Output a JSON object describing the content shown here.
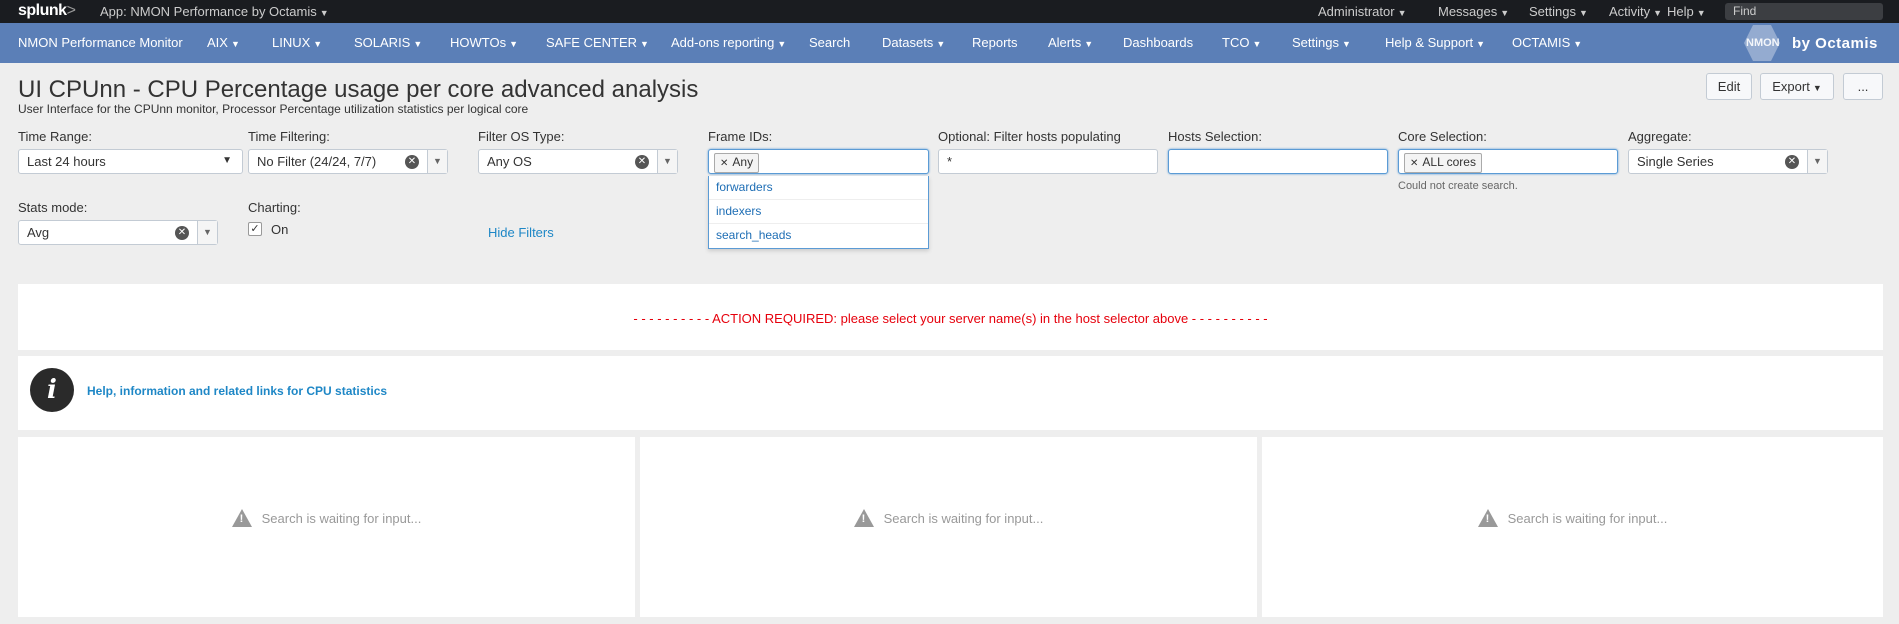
{
  "topbar": {
    "logo": "splunk",
    "logo_chevron": ">",
    "app_label": "App: NMON Performance by Octamis",
    "menus": [
      "Administrator",
      "Messages",
      "Settings",
      "Activity",
      "Help"
    ],
    "find_placeholder": "Find"
  },
  "nav": {
    "items": [
      "NMON Performance Monitor",
      "AIX",
      "LINUX",
      "SOLARIS",
      "HOWTOs",
      "SAFE CENTER",
      "Add-ons reporting",
      "Search",
      "Datasets",
      "Reports",
      "Alerts",
      "Dashboards",
      "TCO",
      "Settings",
      "Help & Support",
      "OCTAMIS"
    ],
    "brand_hex": "NMON",
    "brand": "by Octamis"
  },
  "page": {
    "title": "UI CPUnn - CPU Percentage usage per core advanced analysis",
    "description": "User Interface for the CPUnn monitor, Processor Percentage utilization statistics per logical core",
    "edit_label": "Edit",
    "export_label": "Export",
    "more_label": "..."
  },
  "filters": {
    "time_range": {
      "label": "Time Range:",
      "value": "Last 24 hours"
    },
    "time_filtering": {
      "label": "Time Filtering:",
      "value": "No Filter (24/24, 7/7)"
    },
    "os_type": {
      "label": "Filter OS Type:",
      "value": "Any OS"
    },
    "frame_ids": {
      "label": "Frame IDs:",
      "token": "Any",
      "options": [
        "forwarders",
        "indexers",
        "search_heads"
      ]
    },
    "hosts_populating": {
      "label": "Optional: Filter hosts populating",
      "value": "*"
    },
    "hosts_selection": {
      "label": "Hosts Selection:",
      "value": ""
    },
    "core_selection": {
      "label": "Core Selection:",
      "token": "ALL cores",
      "error": "Could not create search."
    },
    "aggregate": {
      "label": "Aggregate:",
      "value": "Single Series"
    },
    "stats_mode": {
      "label": "Stats mode:",
      "value": "Avg"
    },
    "charting": {
      "label": "Charting:",
      "value": "On",
      "checked": true
    },
    "hide_filters": "Hide Filters"
  },
  "panels": {
    "action_required": "- - - - - - - - - - ACTION REQUIRED: please select your server name(s) in the host selector above - - - - - - - - - -",
    "info_icon": "i",
    "help_link": "Help, information and related links for CPU statistics",
    "waiting": [
      "Search is waiting for input...",
      "Search is waiting for input...",
      "Search is waiting for input..."
    ]
  },
  "colors": {
    "topbar": "#1a1c20",
    "navbar": "#5b7fb7",
    "accent_link": "#1e87c6",
    "alert": "#e6000c"
  }
}
